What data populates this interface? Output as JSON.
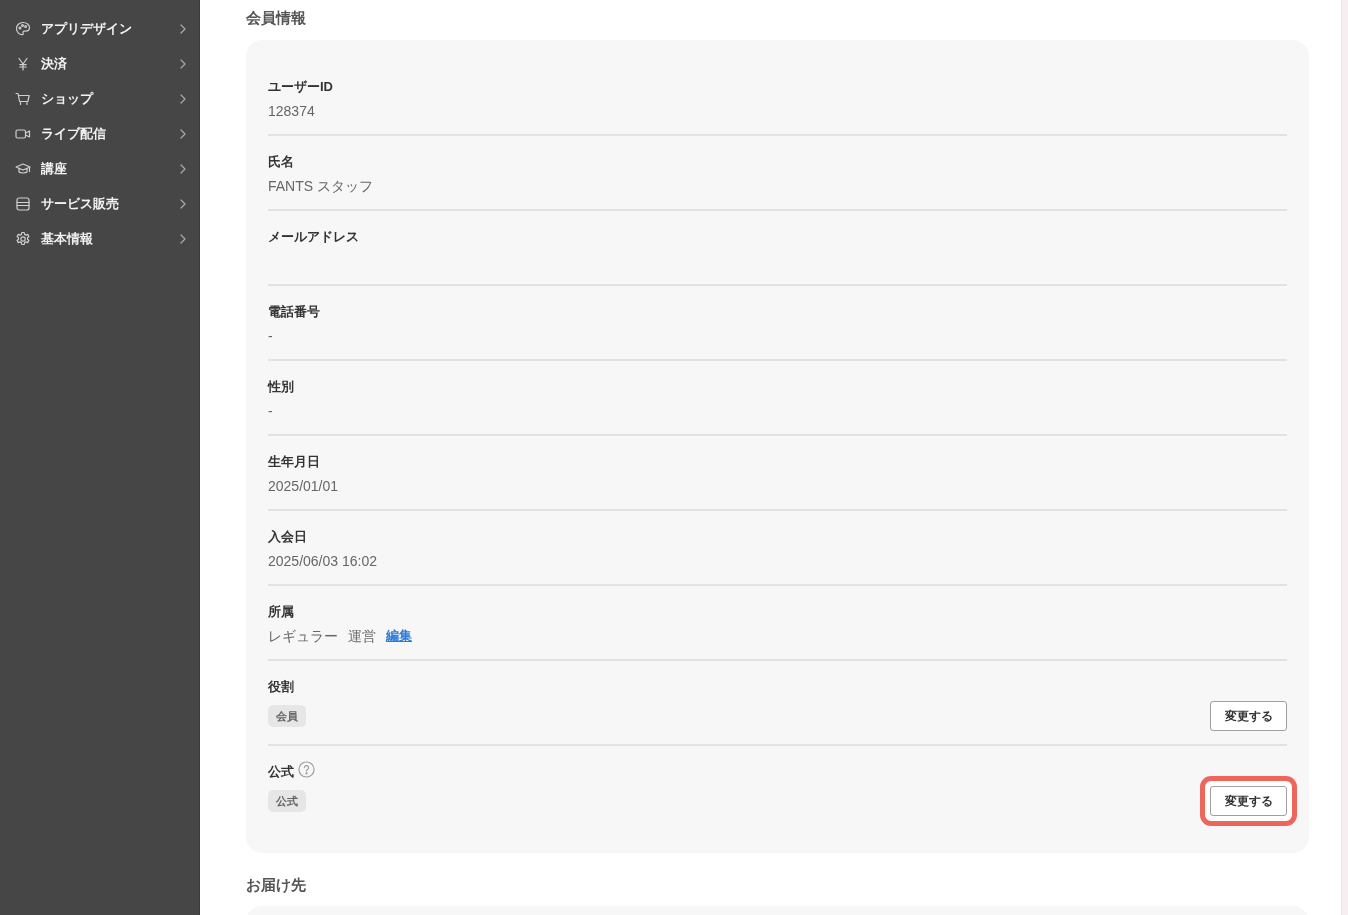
{
  "sidebar": {
    "items": [
      {
        "label": "アプリデザイン",
        "expanded": false
      },
      {
        "label": "決済",
        "expanded": false
      },
      {
        "label": "ショップ",
        "expanded": false
      },
      {
        "label": "ライブ配信",
        "expanded": false
      },
      {
        "label": "講座",
        "expanded": false
      },
      {
        "label": "サービス販売",
        "expanded": false
      },
      {
        "label": "基本情報",
        "expanded": false
      }
    ]
  },
  "member_info": {
    "title": "会員情報",
    "fields": [
      {
        "kind": "text",
        "label": "ユーザーID",
        "help": false,
        "value": "128374"
      },
      {
        "kind": "text",
        "label": "氏名",
        "help": false,
        "value": "FANTS スタッフ"
      },
      {
        "kind": "text",
        "label": "メールアドレス",
        "help": false
      },
      {
        "kind": "text",
        "label": "電話番号",
        "help": false,
        "value": "-"
      },
      {
        "kind": "text",
        "label": "性別",
        "help": false,
        "value": "-"
      },
      {
        "kind": "text",
        "label": "生年月日",
        "help": false,
        "value": "2025/01/01"
      },
      {
        "kind": "text",
        "label": "入会日",
        "help": false,
        "value": "2025/06/03 16:02"
      },
      {
        "kind": "affiliation",
        "label": "所属",
        "help": false,
        "values": [
          "レギュラー",
          "運営"
        ],
        "link": "編集"
      },
      {
        "kind": "tags",
        "label": "役割",
        "help": false,
        "tags": [
          "会員"
        ],
        "button": {
          "label": "変更する",
          "highlighted": false
        }
      },
      {
        "kind": "tags",
        "label": "公式",
        "help": true,
        "tags": [
          "公式"
        ],
        "button": {
          "label": "変更する",
          "highlighted": true
        }
      }
    ]
  },
  "shipping": {
    "title": "お届け先"
  }
}
